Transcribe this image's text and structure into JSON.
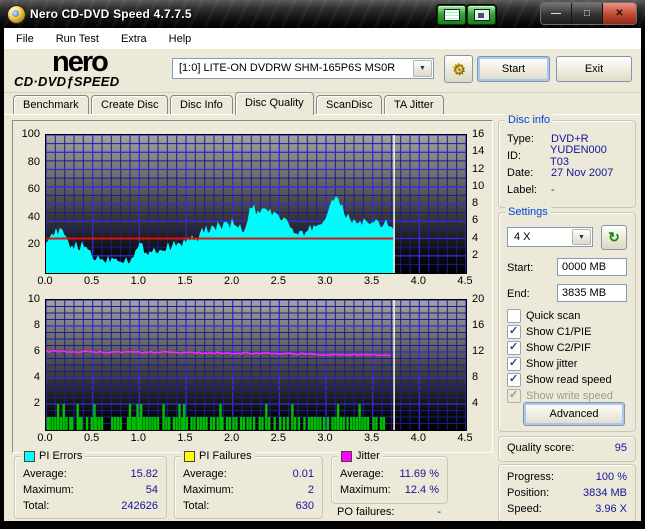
{
  "window": {
    "title": "Nero CD-DVD Speed 4.7.7.5"
  },
  "menu": {
    "items": [
      "File",
      "Run Test",
      "Extra",
      "Help"
    ]
  },
  "logo": {
    "line1": "nero",
    "line2a": "CD·DVD",
    "flame": "ƒ",
    "line2b": "SPEED"
  },
  "header": {
    "drive": "[1:0]  LITE-ON DVDRW SHM-165P6S MS0R",
    "start": "Start",
    "exit": "Exit"
  },
  "tabs": {
    "items": [
      "Benchmark",
      "Create Disc",
      "Disc Info",
      "Disc Quality",
      "ScanDisc",
      "TA Jitter"
    ],
    "active_index": 3
  },
  "disc_info": {
    "title": "Disc info",
    "rows": [
      [
        "Type:",
        "DVD+R"
      ],
      [
        "ID:",
        "YUDEN000 T03"
      ],
      [
        "Date:",
        "27 Nov 2007"
      ],
      [
        "Label:",
        "-"
      ]
    ]
  },
  "settings": {
    "title": "Settings",
    "speed_value": "4 X",
    "start_label": "Start:",
    "start_value": "0000 MB",
    "end_label": "End:",
    "end_value": "3835 MB",
    "checkboxes": [
      {
        "label": "Quick scan",
        "checked": false,
        "disabled": false
      },
      {
        "label": "Show C1/PIE",
        "checked": true,
        "disabled": false
      },
      {
        "label": "Show C2/PIF",
        "checked": true,
        "disabled": false
      },
      {
        "label": "Show jitter",
        "checked": true,
        "disabled": false
      },
      {
        "label": "Show read speed",
        "checked": true,
        "disabled": false
      },
      {
        "label": "Show write speed",
        "checked": true,
        "disabled": true
      }
    ],
    "advanced": "Advanced"
  },
  "quality": {
    "label": "Quality score:",
    "value": "95"
  },
  "progress": {
    "rows": [
      [
        "Progress:",
        "100 %"
      ],
      [
        "Position:",
        "3834 MB"
      ],
      [
        "Speed:",
        "3.96 X"
      ]
    ]
  },
  "summaries": [
    {
      "title": "PI Errors",
      "swatch": "#00FFFF",
      "rows": [
        [
          "Average:",
          "15.82"
        ],
        [
          "Maximum:",
          "54"
        ],
        [
          "Total:",
          "242626"
        ]
      ]
    },
    {
      "title": "PI Failures",
      "swatch": "#FFFF00",
      "rows": [
        [
          "Average:",
          "0.01"
        ],
        [
          "Maximum:",
          "2"
        ],
        [
          "Total:",
          "630"
        ]
      ]
    },
    {
      "title": "Jitter",
      "swatch": "#FF00FF",
      "rows": [
        [
          "Average:",
          "11.69 %"
        ],
        [
          "Maximum:",
          "12.4 %"
        ]
      ]
    }
  ],
  "po": {
    "label": "PO failures:",
    "value": "-"
  },
  "colors": {
    "grid_minor": "#1c1c96",
    "grid_major": "#2e2ee0",
    "cursor": "#f0f0f0"
  },
  "chart_data": [
    {
      "name": "pi-errors-chart",
      "type": "area",
      "title": "PI Errors / read speed vs disc position (GB)",
      "xlim": [
        0,
        4.5
      ],
      "x_tick_labels": [
        "0.0",
        "0.5",
        "1.0",
        "1.5",
        "2.0",
        "2.5",
        "3.0",
        "3.5",
        "4.0",
        "4.5"
      ],
      "left_max": 100,
      "left_ticks": [
        100,
        80,
        60,
        40,
        20
      ],
      "right_max": 16,
      "right_ticks": [
        16,
        14,
        12,
        10,
        8,
        6,
        4,
        2
      ],
      "grid": {
        "x_minor": 0.1,
        "x_major": 0.5,
        "y_divs": 16,
        "y_major_every": 2
      },
      "cursor_x": 3.73,
      "series": [
        {
          "name": "PI Errors",
          "type": "area",
          "color": "#00FBFB",
          "axis_max": 100,
          "x_start": 0,
          "x_step": 0.05,
          "values": [
            25,
            27,
            28,
            30,
            26,
            20,
            19,
            18,
            19,
            17,
            12,
            10,
            10,
            9,
            10,
            11,
            10,
            9,
            10,
            12,
            20,
            17,
            15,
            16,
            17,
            16,
            18,
            20,
            19,
            21,
            22,
            26,
            21,
            28,
            30,
            32,
            33,
            34,
            33,
            34,
            36,
            32,
            31,
            33,
            49,
            43,
            42,
            45,
            46,
            41,
            40,
            39,
            36,
            28,
            26,
            28,
            29,
            33,
            34,
            35,
            40,
            51,
            55,
            48,
            43,
            38,
            37,
            36,
            37,
            34,
            35,
            36,
            34,
            36,
            33,
            30
          ]
        },
        {
          "name": "Read speed",
          "type": "line",
          "color": "#DE1212",
          "axis_max": 16,
          "width": 2,
          "x": [
            0,
            3.73
          ],
          "y": [
            4,
            4
          ]
        }
      ]
    },
    {
      "name": "pi-failures-jitter-chart",
      "type": "mixed",
      "title": "PI Failures / jitter vs disc position (GB)",
      "xlim": [
        0,
        4.5
      ],
      "x_tick_labels": [
        "0.0",
        "0.5",
        "1.0",
        "1.5",
        "2.0",
        "2.5",
        "3.0",
        "3.5",
        "4.0",
        "4.5"
      ],
      "left_max": 10,
      "left_ticks": [
        10,
        8,
        6,
        4,
        2
      ],
      "right_max": 20,
      "right_ticks": [
        20,
        16,
        12,
        8,
        4
      ],
      "grid": {
        "x_minor": 0.1,
        "x_major": 0.5,
        "y_divs": 20,
        "y_major_every": 4
      },
      "cursor_x": 3.73,
      "series": [
        {
          "name": "PI Failures",
          "type": "bars",
          "color": "#00BE00",
          "axis_max": 10,
          "bar_width": 2.4,
          "bars": [
            [
              0.02,
              1
            ],
            [
              0.04,
              1
            ],
            [
              0.07,
              1
            ],
            [
              0.1,
              1
            ],
            [
              0.13,
              2
            ],
            [
              0.16,
              1
            ],
            [
              0.19,
              2
            ],
            [
              0.22,
              1
            ],
            [
              0.26,
              1
            ],
            [
              0.28,
              1
            ],
            [
              0.34,
              2
            ],
            [
              0.36,
              1
            ],
            [
              0.38,
              1
            ],
            [
              0.44,
              1
            ],
            [
              0.49,
              1
            ],
            [
              0.52,
              2
            ],
            [
              0.54,
              1
            ],
            [
              0.57,
              1
            ],
            [
              0.6,
              1
            ],
            [
              0.71,
              1
            ],
            [
              0.74,
              1
            ],
            [
              0.77,
              1
            ],
            [
              0.8,
              1
            ],
            [
              0.88,
              1
            ],
            [
              0.9,
              2
            ],
            [
              0.93,
              1
            ],
            [
              0.95,
              1
            ],
            [
              0.98,
              2
            ],
            [
              1.0,
              1
            ],
            [
              1.02,
              2
            ],
            [
              1.05,
              1
            ],
            [
              1.08,
              1
            ],
            [
              1.11,
              1
            ],
            [
              1.14,
              1
            ],
            [
              1.17,
              1
            ],
            [
              1.2,
              1
            ],
            [
              1.26,
              2
            ],
            [
              1.29,
              1
            ],
            [
              1.32,
              1
            ],
            [
              1.37,
              1
            ],
            [
              1.4,
              1
            ],
            [
              1.43,
              2
            ],
            [
              1.46,
              1
            ],
            [
              1.48,
              2
            ],
            [
              1.51,
              1
            ],
            [
              1.56,
              1
            ],
            [
              1.59,
              1
            ],
            [
              1.63,
              1
            ],
            [
              1.66,
              1
            ],
            [
              1.69,
              1
            ],
            [
              1.72,
              1
            ],
            [
              1.77,
              1
            ],
            [
              1.8,
              1
            ],
            [
              1.84,
              1
            ],
            [
              1.87,
              2
            ],
            [
              1.89,
              1
            ],
            [
              1.94,
              1
            ],
            [
              1.97,
              1
            ],
            [
              2.01,
              1
            ],
            [
              2.04,
              1
            ],
            [
              2.09,
              1
            ],
            [
              2.12,
              1
            ],
            [
              2.16,
              1
            ],
            [
              2.19,
              1
            ],
            [
              2.23,
              1
            ],
            [
              2.29,
              1
            ],
            [
              2.32,
              1
            ],
            [
              2.36,
              2
            ],
            [
              2.39,
              1
            ],
            [
              2.45,
              1
            ],
            [
              2.51,
              1
            ],
            [
              2.55,
              1
            ],
            [
              2.59,
              1
            ],
            [
              2.64,
              2
            ],
            [
              2.67,
              1
            ],
            [
              2.71,
              1
            ],
            [
              2.77,
              1
            ],
            [
              2.82,
              1
            ],
            [
              2.85,
              1
            ],
            [
              2.88,
              1
            ],
            [
              2.91,
              1
            ],
            [
              2.94,
              1
            ],
            [
              2.98,
              1
            ],
            [
              3.02,
              1
            ],
            [
              3.07,
              1
            ],
            [
              3.1,
              1
            ],
            [
              3.13,
              2
            ],
            [
              3.16,
              1
            ],
            [
              3.19,
              1
            ],
            [
              3.23,
              1
            ],
            [
              3.27,
              1
            ],
            [
              3.3,
              1
            ],
            [
              3.33,
              1
            ],
            [
              3.36,
              2
            ],
            [
              3.39,
              1
            ],
            [
              3.42,
              1
            ],
            [
              3.45,
              1
            ],
            [
              3.51,
              1
            ],
            [
              3.54,
              1
            ],
            [
              3.59,
              1
            ],
            [
              3.62,
              1
            ]
          ]
        },
        {
          "name": "Jitter",
          "type": "line",
          "color": "#FF22FF",
          "axis_max": 10,
          "width": 1.6,
          "noise": 0.9,
          "x": [
            0,
            0.25,
            0.5,
            0.75,
            1.0,
            1.25,
            1.5,
            1.75,
            2.0,
            2.25,
            2.5,
            2.75,
            3.0,
            3.25,
            3.5,
            3.7
          ],
          "y": [
            6.05,
            6.02,
            6.0,
            5.98,
            5.97,
            5.96,
            5.95,
            5.93,
            5.9,
            5.9,
            5.87,
            5.85,
            5.82,
            5.8,
            5.78,
            5.76
          ]
        }
      ]
    }
  ]
}
